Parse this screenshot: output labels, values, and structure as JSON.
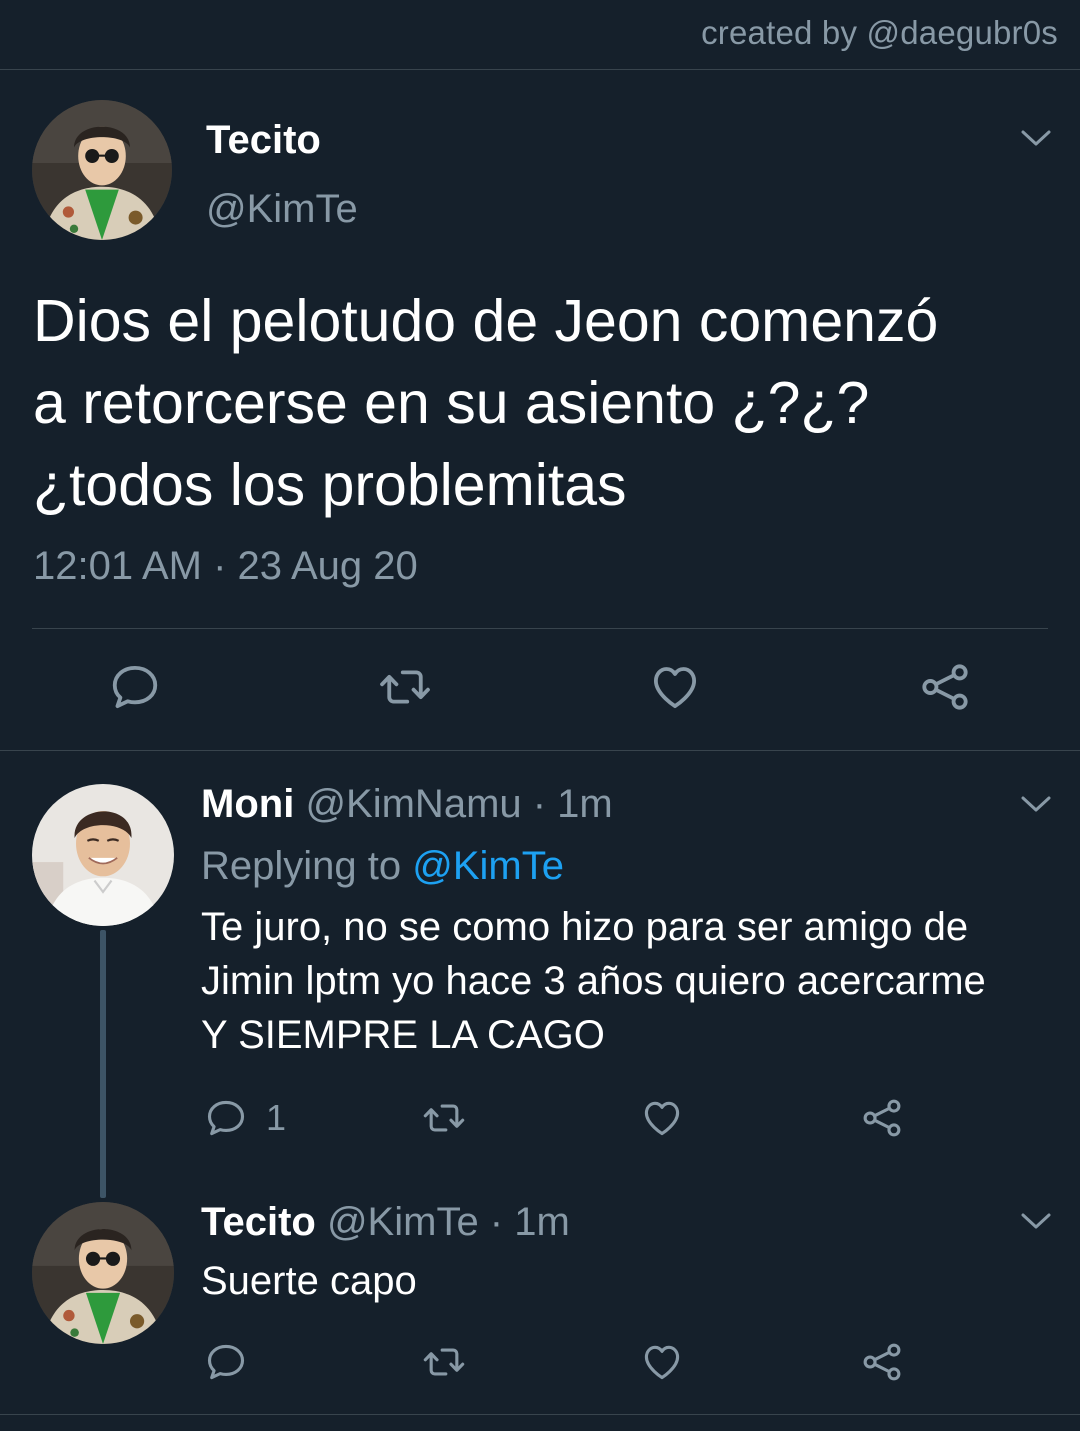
{
  "credit": "created by @daegubr0s",
  "main_tweet": {
    "name": "Tecito",
    "handle": "@KimTe",
    "lines": [
      "Dios el pelotudo de Jeon comenzó",
      "a retorcerse en su asiento ¿?¿?",
      "¿todos los problemitas"
    ],
    "timestamp": "12:01 AM · 23 Aug 20",
    "avatar_icon": "user-avatar-icon",
    "menu_icon": "chevron-down-icon"
  },
  "replies": [
    {
      "name": "Moni",
      "handle": "@KimNamu · 1m",
      "replying_prefix": "Replying to",
      "replying_to": "@KimTe",
      "lines": [
        "Te juro, no se como hizo para ser amigo de",
        "Jimin lptm yo hace 3 años quiero acercarme",
        "Y SIEMPRE LA CAGO"
      ],
      "reply_count": "1"
    },
    {
      "name": "Tecito",
      "handle": "@KimTe · 1m",
      "lines": [
        "Suerte capo"
      ]
    }
  ],
  "icons": {
    "reply": "reply-icon",
    "retweet": "retweet-icon",
    "like": "heart-icon",
    "share": "share-icon"
  },
  "colors": {
    "background": "#15202b",
    "divider": "#38444d",
    "secondary_text": "#8899a6",
    "link": "#1da1f2",
    "primary_text": "#ffffff"
  }
}
